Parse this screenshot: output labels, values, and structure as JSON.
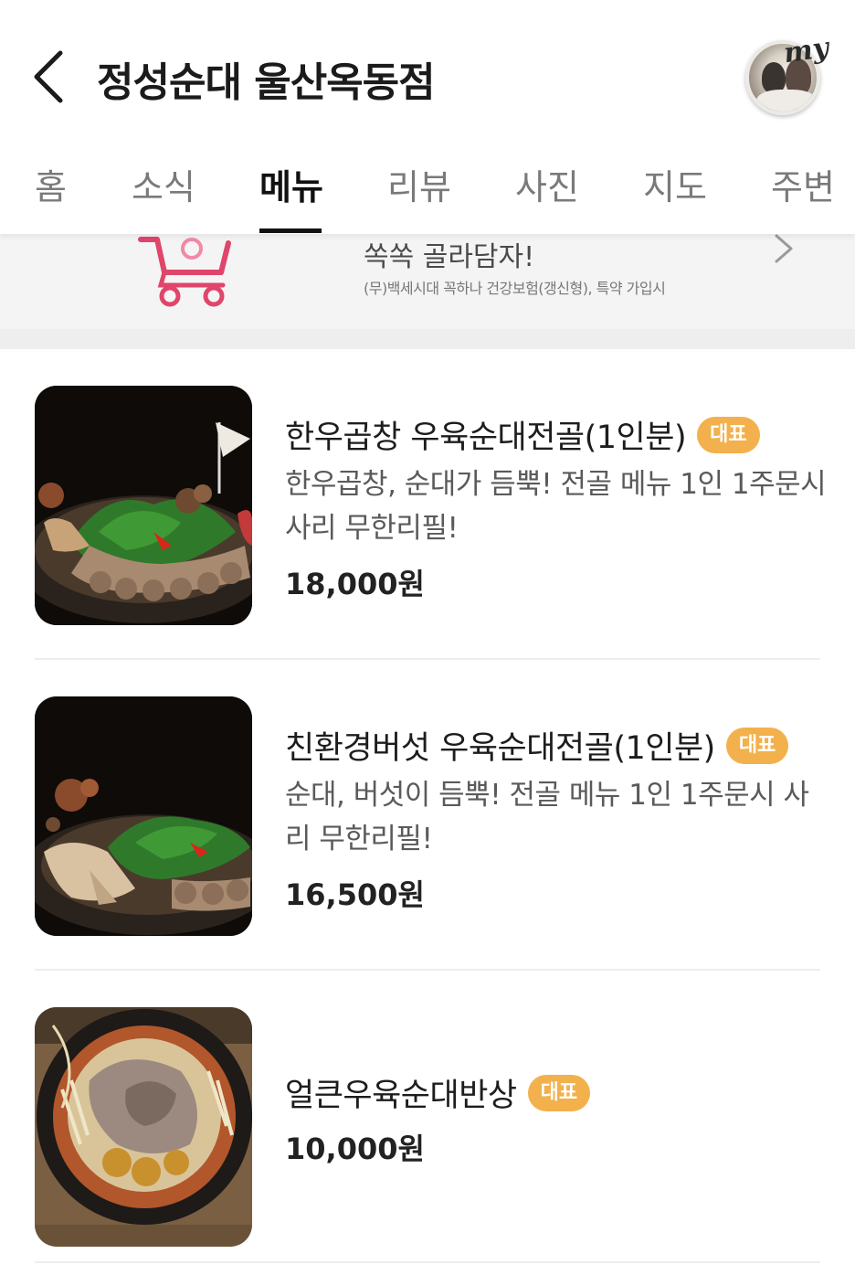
{
  "header": {
    "title": "정성순대 울산옥동점",
    "back_icon": "chevron-left-icon",
    "my_badge": "my"
  },
  "tabs": [
    {
      "label": "홈",
      "active": false
    },
    {
      "label": "소식",
      "active": false
    },
    {
      "label": "메뉴",
      "active": true
    },
    {
      "label": "리뷰",
      "active": false
    },
    {
      "label": "사진",
      "active": false
    },
    {
      "label": "지도",
      "active": false
    },
    {
      "label": "주변",
      "active": false
    }
  ],
  "banner": {
    "title": "쏙쏙 골라담자!",
    "subtitle": "(무)백세시대 꼭하나 건강보험(갱신형), 특약 가입시",
    "icon": "shopping-cart-icon"
  },
  "menu": [
    {
      "name": "한우곱창 우육순대전골(1인분)",
      "badge": "대표",
      "description": "한우곱창, 순대가 듬뿍! 전골 메뉴 1인 1주문시 사리 무한리필!",
      "price": "18,000원"
    },
    {
      "name": "친환경버섯 우육순대전골(1인분)",
      "badge": "대표",
      "description": "순대, 버섯이 듬뿍! 전골 메뉴 1인 1주문시 사리 무한리필!",
      "price": "16,500원"
    },
    {
      "name": "얼큰우육순대반상",
      "badge": "대표",
      "description": "",
      "price": "10,000원"
    }
  ],
  "colors": {
    "badge": "#f2b14c",
    "cart_icon": "#e0456a",
    "banner_bg": "#f4f4f4"
  }
}
